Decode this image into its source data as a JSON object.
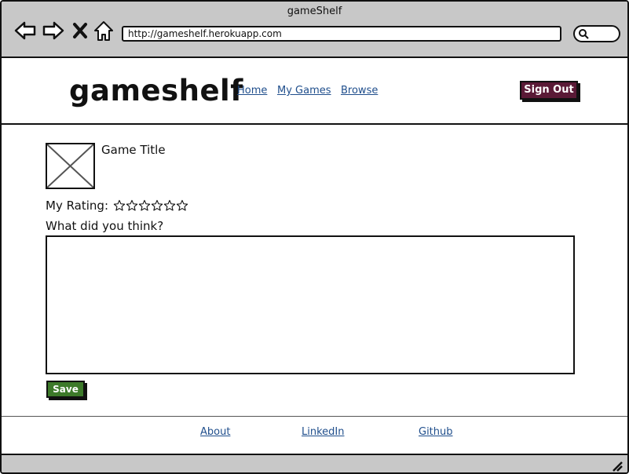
{
  "browser": {
    "window_title": "gameShelf",
    "url": "http://gameshelf.herokuapp.com"
  },
  "header": {
    "logo": "gameshelf",
    "nav": [
      {
        "label": "Home"
      },
      {
        "label": "My Games"
      },
      {
        "label": "Browse"
      }
    ],
    "signout_label": "Sign Out"
  },
  "main": {
    "game_title": "Game Title",
    "rating_label": "My Rating:",
    "rating": {
      "value": 0,
      "max": 6
    },
    "question": "What did you think?",
    "review_value": "",
    "save_label": "Save"
  },
  "footer": {
    "links": [
      {
        "label": "About"
      },
      {
        "label": "LinkedIn"
      },
      {
        "label": "Github"
      }
    ]
  },
  "colors": {
    "chrome": "#c8c8c8",
    "signout": "#5a1a36",
    "save": "#3d7a2a",
    "link": "#1f4e8c"
  }
}
